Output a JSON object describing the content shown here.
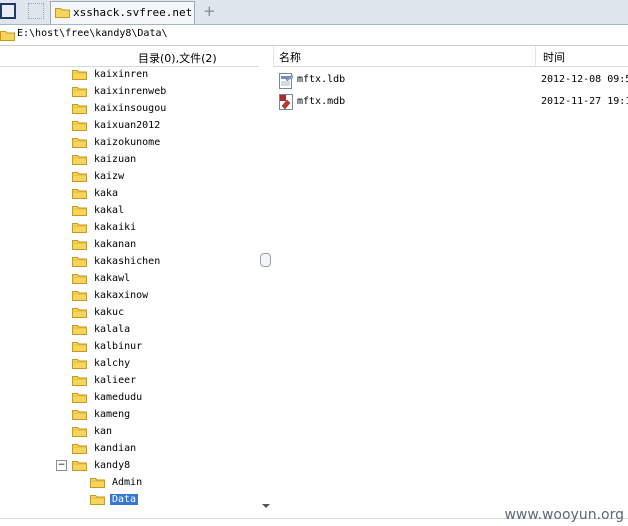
{
  "tab": {
    "title": "xsshack.svfree.net",
    "new_tab": "+"
  },
  "address": {
    "path": "E:\\host\\free\\kandy8\\Data\\"
  },
  "columns": {
    "tree_header": "目录(0),文件(2)",
    "name": "名称",
    "time": "时间"
  },
  "tree": {
    "items": [
      "kaixinren",
      "kaixinrenweb",
      "kaixinsougou",
      "kaixuan2012",
      "kaizokunome",
      "kaizuan",
      "kaizw",
      "kaka",
      "kakal",
      "kakaiki",
      "kakanan",
      "kakashichen",
      "kakawl",
      "kakaxinow",
      "kakuc",
      "kalala",
      "kalbinur",
      "kalchy",
      "kalieer",
      "kamedudu",
      "kameng",
      "kan",
      "kandian"
    ],
    "expanded": {
      "label": "kandy8",
      "toggle": "−"
    },
    "children": [
      "Admin",
      "Data"
    ],
    "selected": "Data"
  },
  "files": [
    {
      "name": "mftx.ldb",
      "time": "2012-12-08 09:5",
      "icon": "ldb-file-icon"
    },
    {
      "name": "mftx.mdb",
      "time": "2012-11-27 19:1",
      "icon": "mdb-file-icon"
    }
  ],
  "watermark": "www.wooyun.org"
}
